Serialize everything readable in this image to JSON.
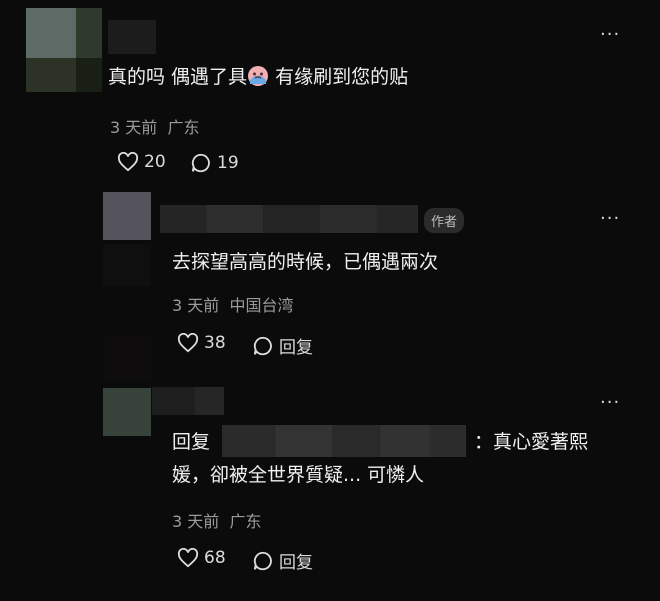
{
  "comments": [
    {
      "text": "真的吗 偶遇了具",
      "text_after_emoji": " 有缘刷到您的贴",
      "time": "3 天前",
      "location": "广东",
      "likes": "20",
      "replies": "19"
    },
    {
      "badge": "作者",
      "text": "去探望高高的時候，已偶遇兩次",
      "time": "3 天前",
      "location": "中国台湾",
      "likes": "38",
      "reply_label": "回复"
    },
    {
      "reply_prefix": "回复",
      "text_line1": "：真心愛著熙",
      "text_line2": "媛，卻被全世界質疑... 可憐人",
      "time": "3 天前",
      "location": "广东",
      "likes": "68",
      "reply_label": "回复"
    }
  ],
  "more_symbol": "···",
  "colors": {
    "background": "#0b0b0b",
    "text": "#f0f0f0",
    "meta": "#9b9b9b"
  }
}
